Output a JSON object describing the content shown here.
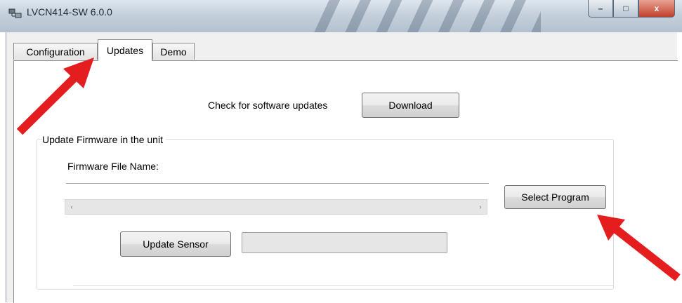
{
  "window": {
    "title": "LVCN414-SW 6.0.0",
    "buttons": {
      "minimize": "–",
      "maximize": "□",
      "close": "x"
    }
  },
  "tabs": [
    {
      "label": "Configuration",
      "active": false
    },
    {
      "label": "Updates",
      "active": true
    },
    {
      "label": "Demo",
      "active": false
    }
  ],
  "updates": {
    "check_label": "Check for software updates",
    "download_button": "Download",
    "group_title": "Update Firmware in the unit",
    "firmware_file_label": "Firmware File Name:",
    "firmware_file_value": "",
    "select_program_button": "Select Program",
    "update_sensor_button": "Update Sensor",
    "progress_fraction": 0
  },
  "scrollbar": {
    "left_arrow": "‹",
    "right_arrow": "›"
  },
  "colors": {
    "arrow": "#e41e1e",
    "titlebar": "#c5d0dc",
    "close_button": "#c1402b"
  },
  "icons": [
    "app-icon",
    "red-arrow-annotation"
  ]
}
